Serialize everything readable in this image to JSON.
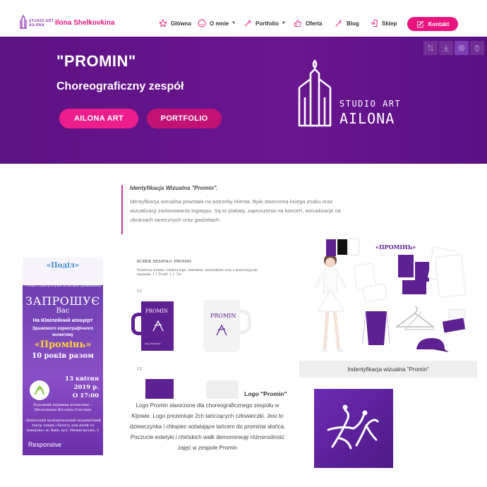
{
  "header": {
    "brand_sub_line1": "STUDIO ART",
    "brand_sub_line2": "AILONA",
    "brand_name": "Ilona Shelkovkina",
    "nav": [
      {
        "label": "Główna",
        "icon": "star-icon"
      },
      {
        "label": "O mnie",
        "icon": "smile-icon",
        "dropdown": true
      },
      {
        "label": "Portfolio",
        "icon": "wand-icon",
        "dropdown": true
      },
      {
        "label": "Oferta",
        "icon": "thumbs-up-icon"
      },
      {
        "label": "Blog",
        "icon": "magic-wand-icon"
      },
      {
        "label": "Sklep",
        "icon": "exit-icon"
      }
    ],
    "contact_label": "Kontakt",
    "contact_icon": "edit-icon",
    "accent": "#e8157f"
  },
  "hero": {
    "title": "\"PROMIN\"",
    "subtitle": "Choreograficzny zespół",
    "button_primary": "AILONA ART",
    "button_secondary": "PORTFOLIO",
    "logo_line1": "STUDIO ART",
    "logo_line2": "AILONA",
    "background": "#5e1283",
    "tools": [
      "sort-icon",
      "download-icon",
      "settings-icon",
      "trash-icon"
    ]
  },
  "intro": {
    "heading": "Identyfikacja Wizualna \"Promin\".",
    "body": "Identyfikacja wizualna powstała na potrzeby klienta. Była stworzona księga znaku oraz wizualizacji zastosowania logotypu. Są to plakaty, zaproszenia na koncert, wizualizacje na ubraniach tanecznych oraz gadżetach."
  },
  "poster": {
    "logo": "«Поділ»",
    "small_header": "«Поділ» Центр клубів за місцем проживання",
    "invite": "ЗАПРОШУЄ",
    "you": "Вас",
    "concert": "На Ювілейний концерт",
    "collective": "Зразкового хореографічного колективу",
    "name": "«Промінь»",
    "years": "10 років разом",
    "date_line1": "13 квітня",
    "date_line2": "2019 р.",
    "date_line3": "О 17:00",
    "director": "Художній керівник колективу – Шелковкіна Віталіна Олегівна",
    "address": "«Київський муніципальний академічний театр опери і балету для дітей та юнацтва» м. Київ, вул. Межигірська, 2",
    "overlay": "Responsive"
  },
  "mugs_sheet": {
    "title": "KUBEK ZESPOŁU PROMIN",
    "description": "Fioletowy kubek z białym logo, imieniem, nazwiskiem oraz z motywującym napisem: 1 1 Proiđ: 1 2. Tyl",
    "num1": "1.1",
    "num2": "1.2",
    "mug_label": "PROMIN",
    "mug_small": "Imię Nazwisko"
  },
  "identity": {
    "label": "«ПРОМІНЬ»",
    "caption": "Indentyfikacja wizualna \"Promin\""
  },
  "logo_section": {
    "title": "Logo \"Promin\"",
    "body": "Logo Promin stworzone dla choreograficznego zespołu w Kijowie. Logo prezentuje 2ch tańczących człowieczki. Jest to dziewczynka i chłopiec wzlatające tańcem do prominia słońca. Poczucie estetyki i chińskich walk demonsreuję różnorodność zajęć w zespole Promin"
  }
}
